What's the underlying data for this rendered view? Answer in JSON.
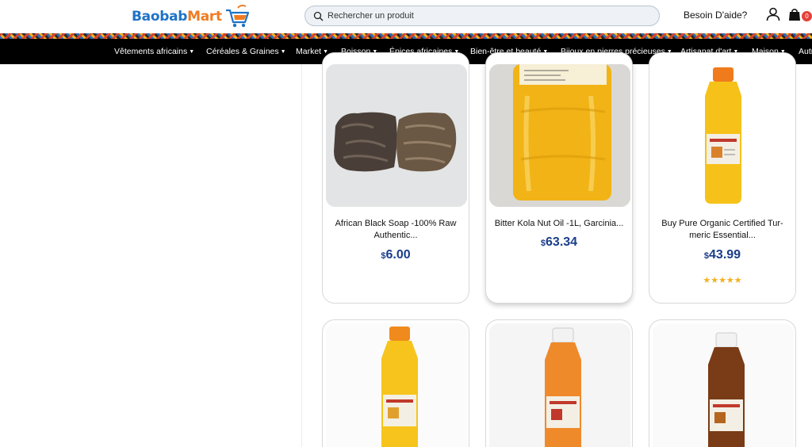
{
  "header": {
    "logo": {
      "part1": "Baobab",
      "part2": "Mart"
    },
    "search": {
      "placeholder": "Rechercher un produit",
      "value": ""
    },
    "help_label": "Besoin D'aide?",
    "cart_count": "0",
    "icons": {
      "search": "search-icon",
      "user": "user-icon",
      "cart": "shopping-bag-icon"
    }
  },
  "nav": {
    "items": [
      {
        "label": "Vêtements africains"
      },
      {
        "label": "Céréales & Graines"
      },
      {
        "label": "Market"
      },
      {
        "label": "Boisson"
      },
      {
        "label": "Épices africaines"
      },
      {
        "label": "Bien-être et beauté"
      },
      {
        "label": "Bijoux en pierres précieuses"
      },
      {
        "label": "Artisanat d'art"
      },
      {
        "label": "Maison"
      },
      {
        "label": "Autr"
      }
    ]
  },
  "products": [
    {
      "title_line1": "African Black Soap -100% Raw",
      "title_line2": "Authentic...",
      "currency": "$",
      "price": "6.00",
      "rating": "",
      "image": "black-soap"
    },
    {
      "title_line1": "Bitter Kola Nut Oil -1L, Garcinia...",
      "title_line2": "",
      "currency": "$",
      "price": "63.34",
      "rating": "",
      "image": "oil-bottle-label"
    },
    {
      "title_line1": "Buy Pure Organic Certified Tur-",
      "title_line2": "meric Essential...",
      "currency": "$",
      "price": "43.99",
      "rating": "★★★★★",
      "image": "yellow-oil-bottle"
    },
    {
      "title_line1": "",
      "title_line2": "",
      "currency": "",
      "price": "",
      "rating": "",
      "image": "yellow-oil-bottle"
    },
    {
      "title_line1": "",
      "title_line2": "",
      "currency": "",
      "price": "",
      "rating": "",
      "image": "orange-oil-bottle"
    },
    {
      "title_line1": "",
      "title_line2": "",
      "currency": "",
      "price": "",
      "rating": "",
      "image": "brown-oil-bottle"
    }
  ],
  "colors": {
    "brand_blue": "#1e73c8",
    "brand_orange": "#f07b22",
    "nav_bg": "#000000",
    "price": "#1a3d8a",
    "star": "#f2b01e",
    "badge": "#e4413a"
  }
}
